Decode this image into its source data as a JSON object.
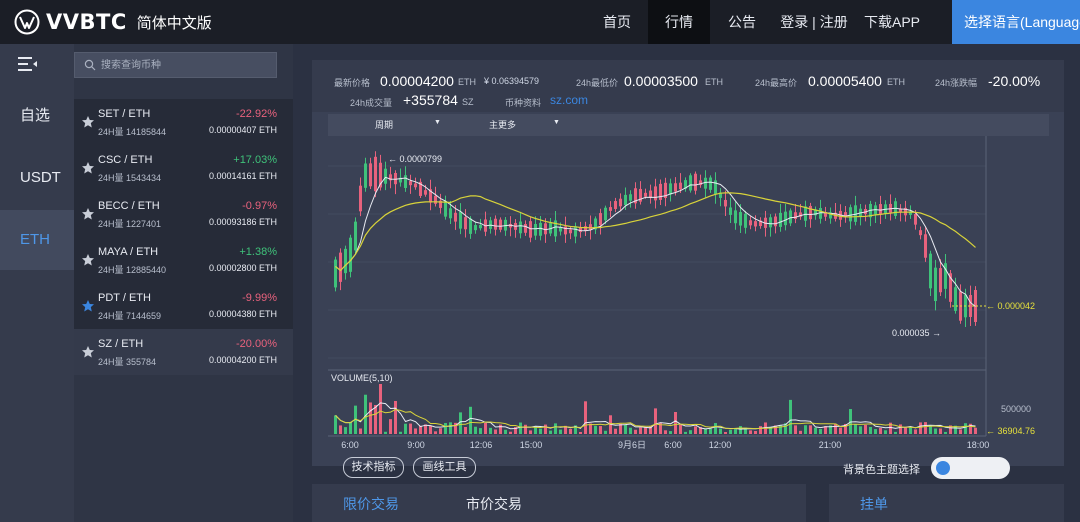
{
  "brand": {
    "name": "VVBTC",
    "edition": "简体中文版"
  },
  "nav": [
    {
      "label": "首页",
      "active": false
    },
    {
      "label": "行情",
      "active": true
    },
    {
      "label": "公告",
      "active": false
    },
    {
      "label": "登录 | 注册",
      "active": false
    },
    {
      "label": "下载APP",
      "active": false
    }
  ],
  "language_button": "选择语言(Language)",
  "market_tabs": [
    {
      "label": "自选",
      "active": false
    },
    {
      "label": "USDT",
      "active": false
    },
    {
      "label": "ETH",
      "active": true
    }
  ],
  "search": {
    "placeholder": "搜索查询币种",
    "value": ""
  },
  "coins": [
    {
      "pair": "SET / ETH",
      "volume": "24H量 14185844",
      "change": "-22.92%",
      "price": "0.00000407 ETH",
      "dir": "down",
      "favorite": false,
      "selected": false
    },
    {
      "pair": "CSC / ETH",
      "volume": "24H量 1543434",
      "change": "+17.03%",
      "price": "0.00014161 ETH",
      "dir": "up",
      "favorite": false,
      "selected": false
    },
    {
      "pair": "BECC / ETH",
      "volume": "24H量 1227401",
      "change": "-0.97%",
      "price": "0.00093186 ETH",
      "dir": "down",
      "favorite": false,
      "selected": false
    },
    {
      "pair": "MAYA / ETH",
      "volume": "24H量 12885440",
      "change": "+1.38%",
      "price": "0.00002800 ETH",
      "dir": "up",
      "favorite": false,
      "selected": false
    },
    {
      "pair": "PDT / ETH",
      "volume": "24H量 7144659",
      "change": "-9.99%",
      "price": "0.00004380 ETH",
      "dir": "down",
      "favorite": true,
      "selected": false
    },
    {
      "pair": "SZ / ETH",
      "volume": "24H量 355784",
      "change": "-20.00%",
      "price": "0.00004200 ETH",
      "dir": "down",
      "favorite": false,
      "selected": true
    }
  ],
  "stats": {
    "last_label": "最新价格",
    "last_value": "0.00004200",
    "last_unit": "ETH",
    "last_fiat": "¥ 0.06394579",
    "low_label": "24h最低价",
    "low_value": "0.00003500",
    "low_unit": "ETH",
    "high_label": "24h最高价",
    "high_value": "0.00005400",
    "high_unit": "ETH",
    "change_label": "24h涨跌幅",
    "change_value": "-20.00%",
    "volume_label": "24h成交量",
    "volume_value": "+355784",
    "volume_unit": "SZ",
    "info_label": "币种资料",
    "info_link": "sz.com"
  },
  "chart_toolbar": {
    "period": "周期",
    "indicator": "主更多"
  },
  "chart": {
    "high_marker": "← 0.0000799",
    "low_marker": "0.000035 →",
    "last_marker": "← 0.000042",
    "volume_label": "VOLUME(5,10)",
    "volume_axis": "500000",
    "volume_last": "← 36904.76",
    "time_ticks": [
      "6:00",
      "9:00",
      "12:06",
      "15:00",
      "9月6日",
      "6:00",
      "12:00",
      "21:00",
      "18:00"
    ],
    "colors": {
      "up": "#3fc27a",
      "down": "#e8627d",
      "ma1": "#e8ebf2",
      "ma2": "#d8d33a",
      "last": "#e6e03c"
    }
  },
  "chart_data": {
    "type": "candlestick",
    "x": [
      "6:00",
      "9:00",
      "12:06",
      "15:00",
      "9月6日",
      "6:00",
      "12:00",
      "21:00",
      "18:00"
    ],
    "annotations": {
      "high": 7.99e-05,
      "low": 3.5e-05,
      "last": 4.2e-05
    },
    "volume_axis_tick": 500000,
    "volume_last": 36904.76
  },
  "buttons": {
    "indicators": "技术指标",
    "drawing": "画线工具",
    "bg_theme": "背景色主题选择"
  },
  "order_tabs": {
    "limit": "限价交易",
    "market": "市价交易",
    "orders": "挂单"
  }
}
